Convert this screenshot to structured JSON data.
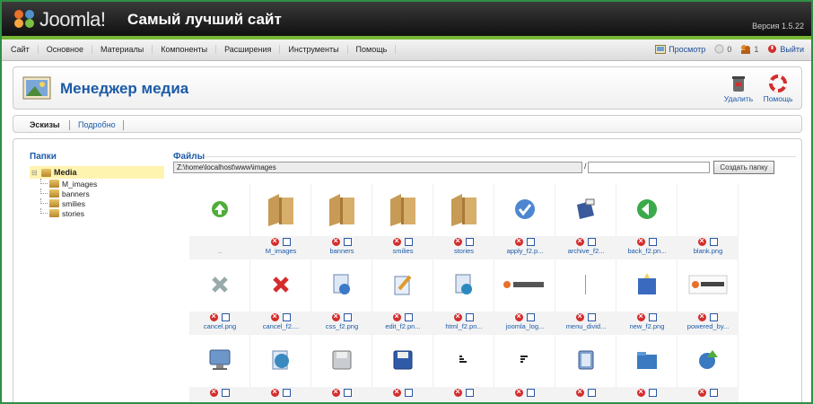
{
  "header": {
    "brand": "Joomla!",
    "site_title": "Самый лучший сайт",
    "version": "Версия 1.5.22"
  },
  "menu": {
    "items": [
      "Сайт",
      "Основное",
      "Материалы",
      "Компоненты",
      "Расширения",
      "Инструменты",
      "Помощь"
    ]
  },
  "status": {
    "preview": "Просмотр",
    "messages": "0",
    "users": "1",
    "logout": "Выйти"
  },
  "toolbar": {
    "title": "Менеджер медиа",
    "delete_label": "Удалить",
    "help_label": "Помощь"
  },
  "view": {
    "thumbs": "Эскизы",
    "details": "Подробно"
  },
  "folders": {
    "title": "Папки",
    "root": "Media",
    "items": [
      "M_images",
      "banners",
      "smilies",
      "stories"
    ]
  },
  "files": {
    "title": "Файлы",
    "path": "Z:\\home\\localhost\\www\\images",
    "path_sep": "/",
    "create_button": "Создать папку",
    "items": [
      {
        "name": "..",
        "icon": "up-arrow-icon"
      },
      {
        "name": "M_images",
        "icon": "folder-icon"
      },
      {
        "name": "banners",
        "icon": "folder-icon"
      },
      {
        "name": "smilies",
        "icon": "folder-icon"
      },
      {
        "name": "stories",
        "icon": "folder-icon"
      },
      {
        "name": "apply_f2.p...",
        "icon": "apply-check-icon"
      },
      {
        "name": "archive_f2...",
        "icon": "archive-icon"
      },
      {
        "name": "back_f2.pn...",
        "icon": "back-arrow-icon"
      },
      {
        "name": "blank.png",
        "icon": "blank-icon"
      },
      {
        "name": "cancel.png",
        "icon": "cancel-gray-icon"
      },
      {
        "name": "cancel_f2....",
        "icon": "cancel-red-icon"
      },
      {
        "name": "css_f2.png",
        "icon": "css-icon"
      },
      {
        "name": "edit_f2.pn...",
        "icon": "edit-icon"
      },
      {
        "name": "html_f2.pn...",
        "icon": "html-icon"
      },
      {
        "name": "joomla_log...",
        "icon": "joomla-logo-icon"
      },
      {
        "name": "menu_divid...",
        "icon": "divider-icon"
      },
      {
        "name": "new_f2.png",
        "icon": "new-icon"
      },
      {
        "name": "powered_by...",
        "icon": "powered-icon"
      },
      {
        "name": "",
        "icon": "monitor-icon"
      },
      {
        "name": "",
        "icon": "globe-icon"
      },
      {
        "name": "",
        "icon": "save-gray-icon"
      },
      {
        "name": "",
        "icon": "save-blue-icon"
      },
      {
        "name": "",
        "icon": "sort-asc-icon"
      },
      {
        "name": "",
        "icon": "sort-desc-icon"
      },
      {
        "name": "",
        "icon": "restore-icon"
      },
      {
        "name": "",
        "icon": "upload-folder-icon"
      },
      {
        "name": "",
        "icon": "upload-globe-icon"
      }
    ]
  },
  "colors": {
    "accent": "#1b5aa8",
    "green_bar": "#76b633",
    "frame": "#2f8f45",
    "selected_folder": "#fff3b0"
  }
}
